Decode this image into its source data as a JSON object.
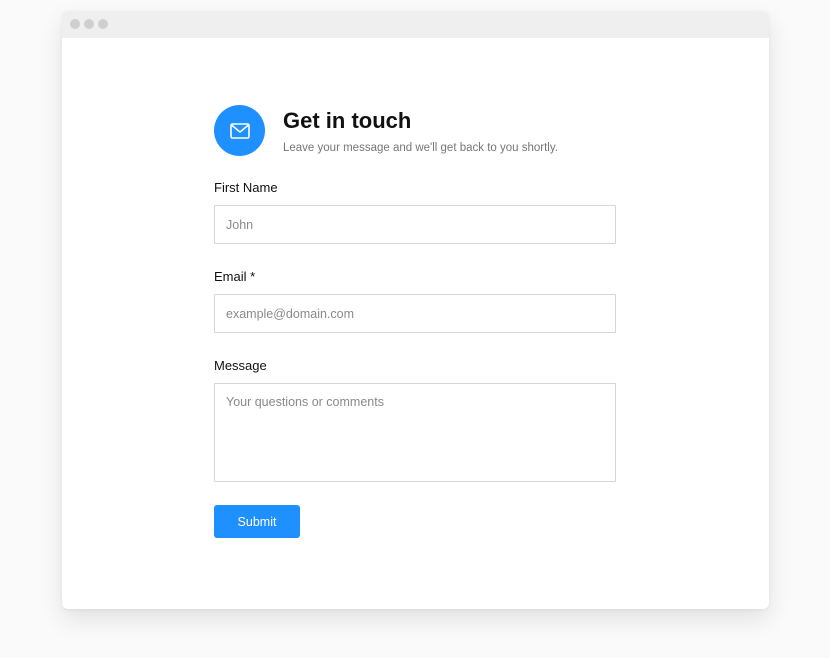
{
  "header": {
    "icon": "mail-icon",
    "accent_color": "#1e90ff",
    "title": "Get in touch",
    "subtitle": "Leave your message and we'll get back to you shortly."
  },
  "form": {
    "first_name": {
      "label": "First Name",
      "placeholder": "John",
      "value": ""
    },
    "email": {
      "label": "Email *",
      "placeholder": "example@domain.com",
      "value": ""
    },
    "message": {
      "label": "Message",
      "placeholder": "Your questions or comments",
      "value": ""
    },
    "submit_label": "Submit"
  }
}
